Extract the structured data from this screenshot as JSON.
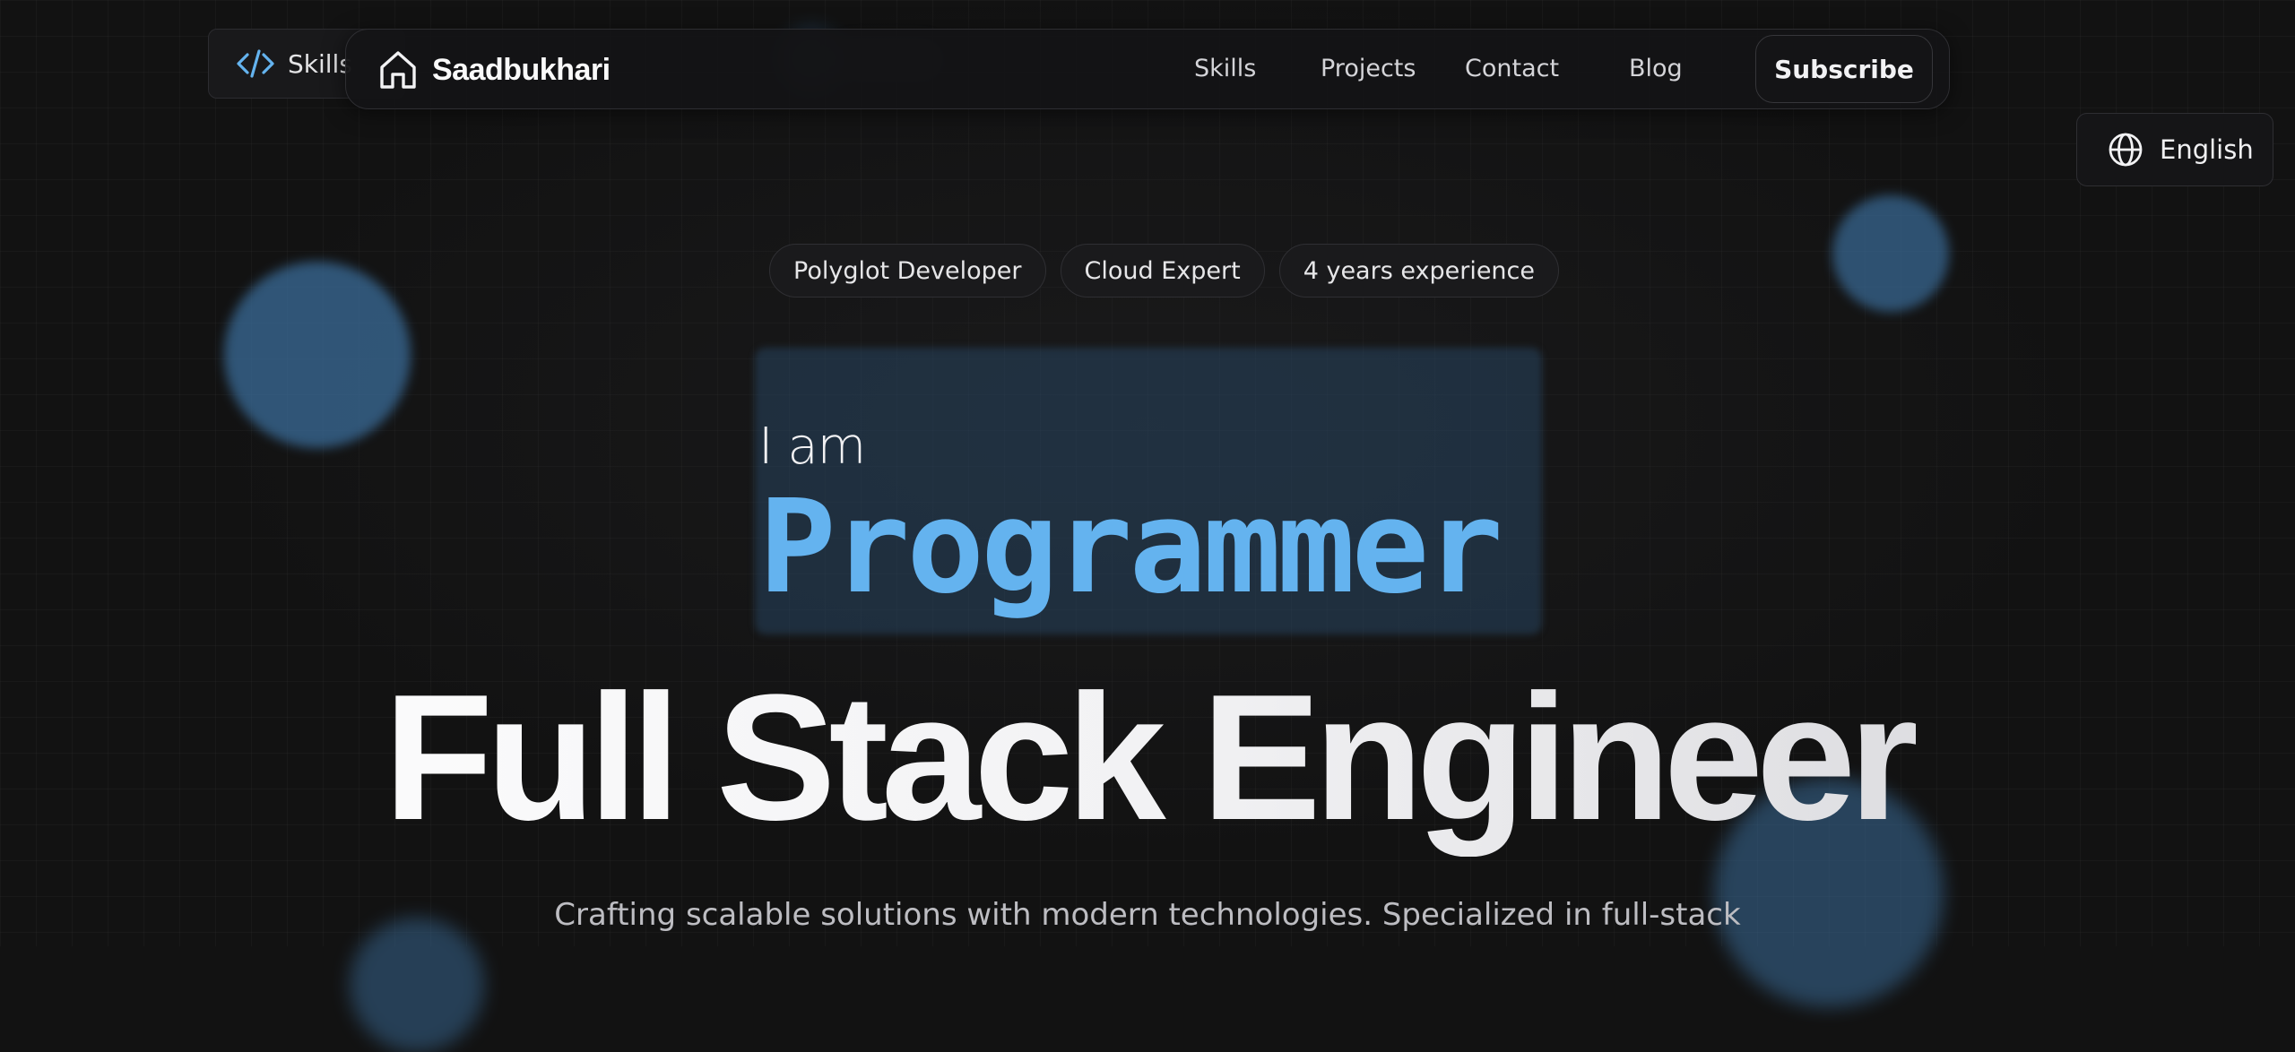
{
  "skills_chip": {
    "label": "Skills",
    "icon": "code-icon"
  },
  "nav": {
    "brand": "Saadbukhari",
    "brand_icon": "home-icon",
    "links": [
      "Skills",
      "Projects",
      "Contact",
      "Blog"
    ],
    "subscribe": "Subscribe"
  },
  "language": {
    "label": "English",
    "icon": "globe-icon"
  },
  "hero": {
    "badges": [
      "Polyglot Developer",
      "Cloud Expert",
      "4 years experience"
    ],
    "intro": "I am",
    "role": "Programmer",
    "headline": "Full Stack Engineer",
    "tagline": "Crafting scalable solutions with modern technologies. Specialized in full-stack"
  },
  "colors": {
    "background": "#121212",
    "accent": "#64b3ef",
    "orb": "#3a6c99"
  }
}
